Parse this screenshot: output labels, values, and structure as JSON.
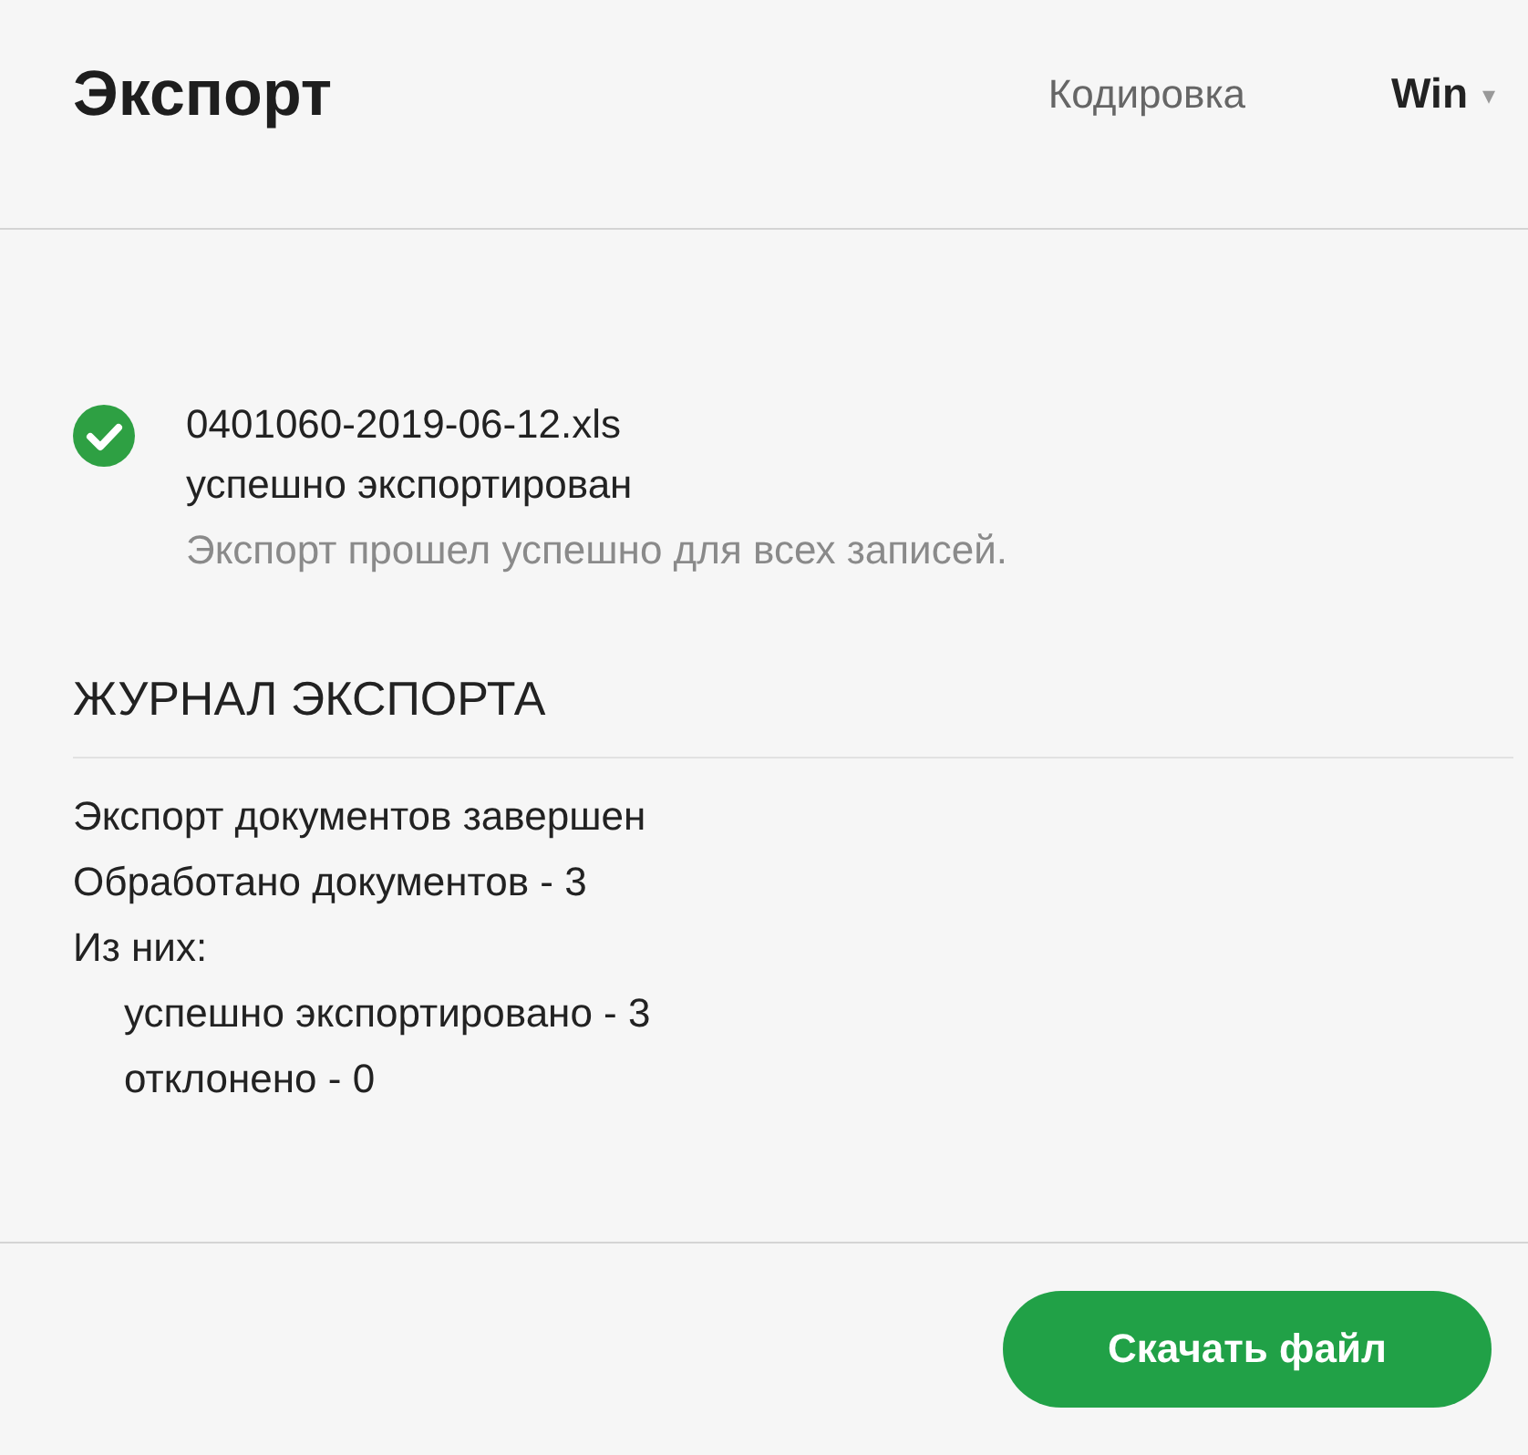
{
  "title": "Экспорт",
  "encoding": {
    "label": "Кодировка",
    "value": "Win",
    "caret": "▾"
  },
  "result": {
    "success": true,
    "filename": "0401060-2019-06-12.xls",
    "headline": "успешно экспортирован",
    "message": "Экспорт прошел успешно для всех записей."
  },
  "log": {
    "title": "ЖУРНАЛ ЭКСПОРТА",
    "lines": [
      {
        "text": "Экспорт документов завершен"
      },
      {
        "text": "Обработано документов - 3"
      },
      {
        "text": "Из них:",
        "children": [
          {
            "text": "успешно экспортировано - 3"
          },
          {
            "text": "отклонено - 0"
          }
        ]
      }
    ]
  },
  "download_button": "Скачать файл"
}
